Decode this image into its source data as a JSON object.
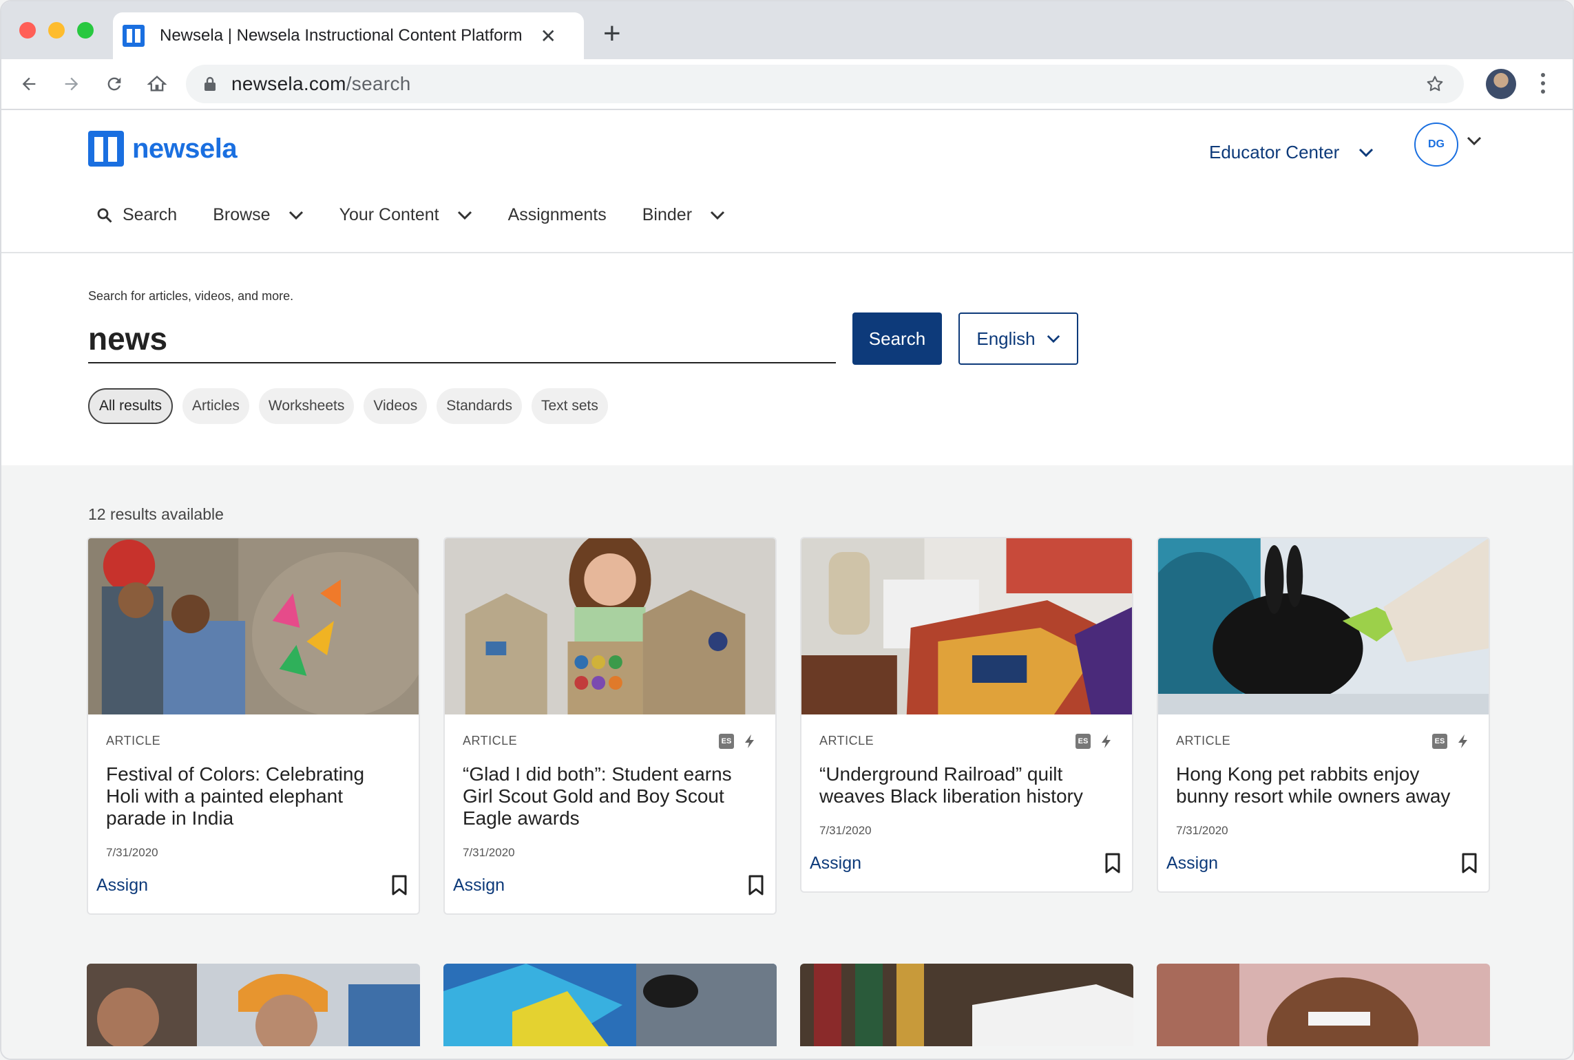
{
  "browser": {
    "tab_title": "Newsela | Newsela Instructional Content Platform",
    "url_domain": "newsela.com",
    "url_path": "/search"
  },
  "header": {
    "logo_text": "newsela",
    "educator_center": "Educator Center",
    "user_initials": "DG",
    "nav": {
      "search": "Search",
      "browse": "Browse",
      "your_content": "Your Content",
      "assignments": "Assignments",
      "binder": "Binder"
    }
  },
  "search": {
    "hint": "Search for articles, videos, and more.",
    "query": "news",
    "button": "Search",
    "language": "English",
    "filters": [
      "All results",
      "Articles",
      "Worksheets",
      "Videos",
      "Standards",
      "Text sets"
    ]
  },
  "results": {
    "count": "12 results available",
    "assign_label": "Assign",
    "badge_es": "ES",
    "cards": [
      {
        "type": "ARTICLE",
        "title": "Festival of Colors: Celebrating Holi with a painted elephant parade in India",
        "date": "7/31/2020"
      },
      {
        "type": "ARTICLE",
        "title": "“Glad I did both”: Student earns Girl Scout Gold and Boy Scout Eagle awards",
        "date": "7/31/2020"
      },
      {
        "type": "ARTICLE",
        "title": "“Underground Railroad” quilt weaves Black liberation history",
        "date": "7/31/2020"
      },
      {
        "type": "ARTICLE",
        "title": "Hong Kong pet rabbits enjoy bunny resort while owners away",
        "date": "7/31/2020"
      }
    ]
  },
  "colors": {
    "brand_blue": "#1a6fe0",
    "navy": "#0d3a7a"
  }
}
